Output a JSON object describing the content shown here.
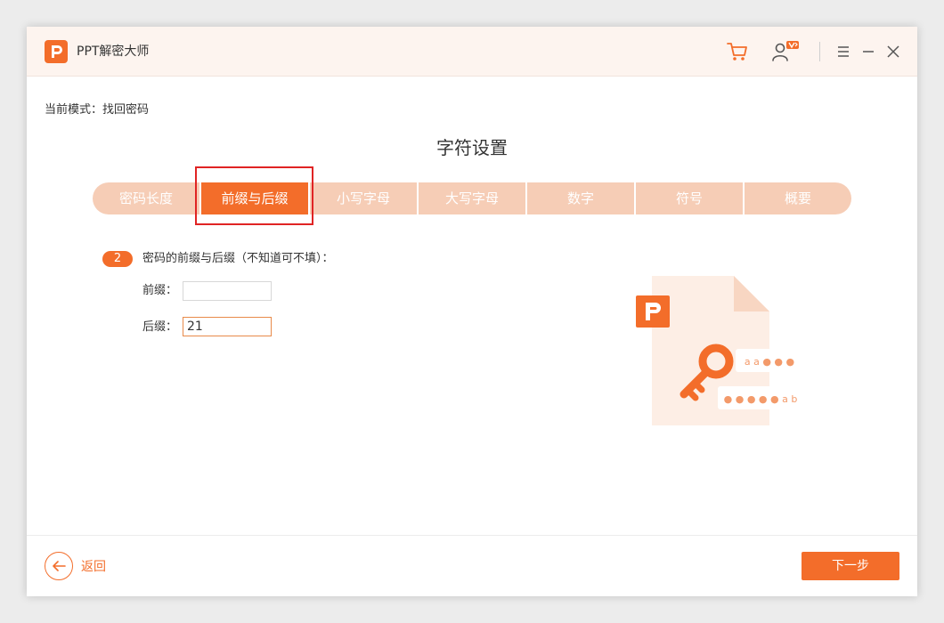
{
  "app": {
    "title": "PPT解密大师",
    "logo_glyph": "P"
  },
  "titlebar": {
    "icons": [
      "cart-icon",
      "user-vip-icon",
      "menu-icon",
      "minimize-icon",
      "close-icon"
    ],
    "vip_badge": "V"
  },
  "mode": {
    "label": "当前模式：找回密码"
  },
  "section": {
    "title": "字符设置"
  },
  "tabs": [
    {
      "label": "密码长度",
      "active": false
    },
    {
      "label": "前缀与后缀",
      "active": true
    },
    {
      "label": "小写字母",
      "active": false
    },
    {
      "label": "大写字母",
      "active": false
    },
    {
      "label": "数字",
      "active": false
    },
    {
      "label": "符号",
      "active": false
    },
    {
      "label": "概要",
      "active": false
    }
  ],
  "step": {
    "number": "2",
    "description": "密码的前缀与后缀（不知道可不填）："
  },
  "fields": {
    "prefix": {
      "label": "前缀：",
      "value": ""
    },
    "suffix": {
      "label": "后缀：",
      "value": "21"
    }
  },
  "illustration": {
    "logo_glyph": "P",
    "mask_top": "a a ● ● ●",
    "mask_bottom": "● ● ● ● ● a b"
  },
  "footer": {
    "back_label": "返回",
    "next_label": "下一步"
  },
  "colors": {
    "accent": "#f36d2a",
    "tab_inactive": "#f6cdb6",
    "titlebar_bg": "#fdf4ef",
    "highlight": "#e02424"
  }
}
